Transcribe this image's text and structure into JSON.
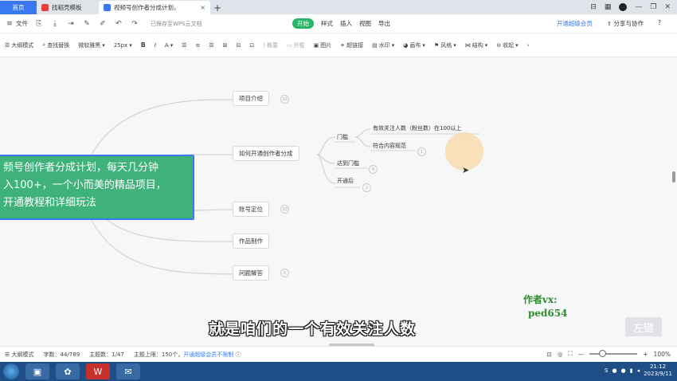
{
  "tabs": {
    "home": "首页",
    "template": "找稻壳模板",
    "document": "视频号创作者分成计划，",
    "close": "×",
    "new": "+"
  },
  "window": {
    "controls": [
      "⊟",
      "▦",
      "—",
      "❐",
      "✕"
    ]
  },
  "menubar": {
    "file": "文件",
    "saved_status": "已保存至WPS云文档",
    "tabs": [
      "开始",
      "样式",
      "插入",
      "视图",
      "导出"
    ],
    "active_tab": "开始",
    "vip": "开通超级会员",
    "share": "分享与协作",
    "help": "?"
  },
  "toolbar": {
    "outline_mode": "大纲模式",
    "find_replace": "查找替换",
    "font": "微软雅黑",
    "font_size": "25px",
    "bold": "B",
    "italic": "I",
    "font_color": "A",
    "subtopic": "概要",
    "outer_frame": "外框",
    "image": "图片",
    "hyperlink": "超链接",
    "watermark": "水印",
    "canvas": "画布",
    "style": "风格",
    "structure": "结构",
    "collapse": "收起"
  },
  "mindmap": {
    "root_lines": [
      "频号创作者分成计划，每天几分钟",
      "入100+，一个小而美的精品项目，",
      "开通教程和详细玩法"
    ],
    "branches": [
      {
        "label": "项目介绍",
        "badge": "10"
      },
      {
        "label": "如何开通创作者分成",
        "badge": ""
      },
      {
        "label": "账号定位",
        "badge": "10"
      },
      {
        "label": "作品制作",
        "badge": ""
      },
      {
        "label": "问题解答",
        "badge": "6"
      }
    ],
    "sub": {
      "threshold": "门槛",
      "reach": "达到门槛",
      "reach_badge": "4",
      "after": "开通后",
      "after_badge": "2",
      "leaf1": "有效关注人数（粉丝数）在100以上",
      "leaf2": "符合内容规范",
      "leaf2_badge": "1"
    }
  },
  "overlay": {
    "subtitle": "就是咱们的一个有效关注人数",
    "author_line1": "作者vx:",
    "author_line2": "ped654",
    "key_hint": "左键"
  },
  "statusbar": {
    "outline": "大纲模式",
    "word_count": "字数：44/789",
    "topic_count": "主题数：1/47",
    "topic_limit": "主题上限：150个，",
    "vip_unlimited": "开通超级会员不限制",
    "zoom": "100%"
  },
  "taskbar": {
    "time": "21:12",
    "date": "2023/9/11"
  },
  "colors": {
    "accent": "#3a78f2",
    "root_fill": "#3fb27c",
    "active_tab": "#25b864",
    "taskbar": "#1f4e86"
  }
}
